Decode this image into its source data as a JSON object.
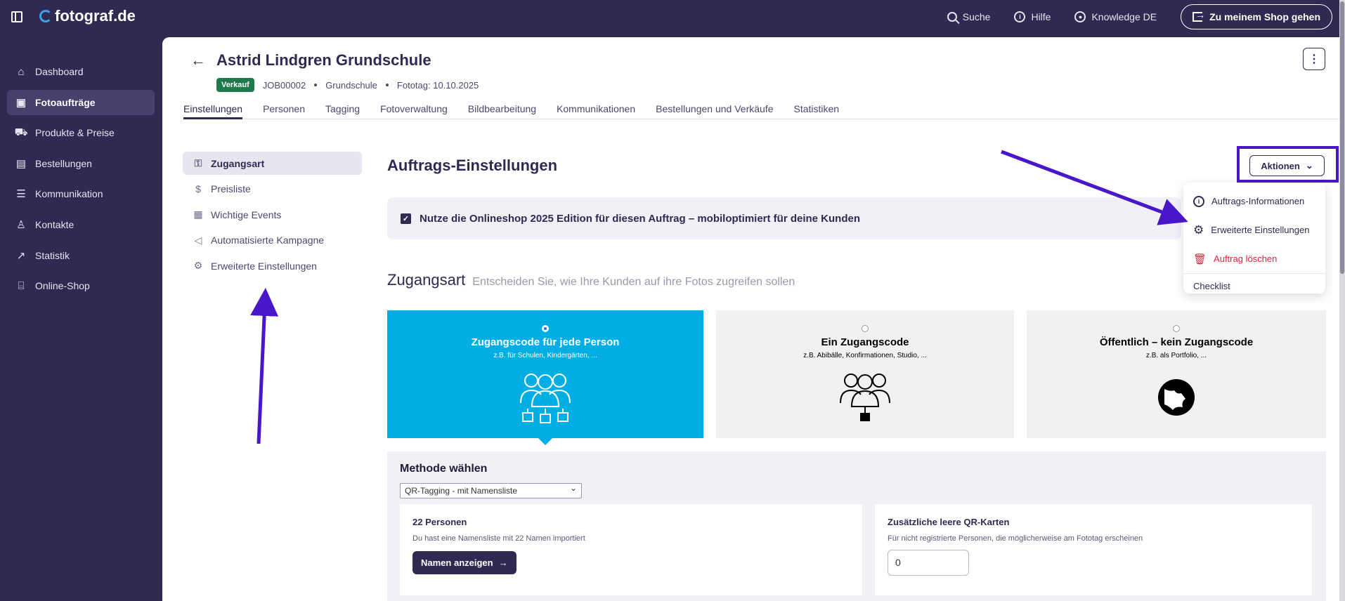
{
  "brand": {
    "name": "fotograf.de"
  },
  "topbar": {
    "search_label": "Suche",
    "help_label": "Hilfe",
    "knowledge_label": "Knowledge DE",
    "shop_button_label": "Zu meinem Shop gehen"
  },
  "sidebar": {
    "items": [
      {
        "label": "Dashboard",
        "icon": "home-icon"
      },
      {
        "label": "Fotoaufträge",
        "icon": "image-icon"
      },
      {
        "label": "Produkte & Preise",
        "icon": "cart-icon"
      },
      {
        "label": "Bestellungen",
        "icon": "box-icon"
      },
      {
        "label": "Kommunikation",
        "icon": "message-icon"
      },
      {
        "label": "Kontakte",
        "icon": "user-icon"
      },
      {
        "label": "Statistik",
        "icon": "chart-icon"
      },
      {
        "label": "Online-Shop",
        "icon": "store-icon"
      }
    ],
    "active_index": 1
  },
  "job": {
    "title": "Astrid Lindgren Grundschule",
    "status_badge": "Verkauf",
    "job_id": "JOB00002",
    "category": "Grundschule",
    "photo_day": "Fototag: 10.10.2025"
  },
  "tabs": [
    "Einstellungen",
    "Personen",
    "Tagging",
    "Fotoverwaltung",
    "Bildbearbeitung",
    "Kommunikationen",
    "Bestellungen und Verkäufe",
    "Statistiken"
  ],
  "subnav": [
    "Zugangsart",
    "Preisliste",
    "Wichtige Events",
    "Automatisierte Kampagne",
    "Erweiterte Einstellungen"
  ],
  "settings": {
    "title": "Auftrags-Einstellungen",
    "actions_label": "Aktionen",
    "edition_checkbox_label": "Nutze die Onlineshop 2025 Edition für diesen Auftrag – mobiloptimiert für deine Kunden",
    "edition_checked": true
  },
  "access": {
    "title": "Zugangsart",
    "subtitle": "Entscheiden Sie, wie Ihre Kunden auf ihre Fotos zugreifen sollen",
    "cards": [
      {
        "title": "Zugangscode für jede Person",
        "sub": "z.B. für Schulen, Kindergärten, ...",
        "selected": true
      },
      {
        "title": "Ein Zugangscode",
        "sub": "z.B. Abibälle, Konfirmationen, Studio, ...",
        "selected": false
      },
      {
        "title": "Öffentlich – kein Zugangscode",
        "sub": "z.B. als Portfolio, ...",
        "selected": false
      }
    ]
  },
  "method": {
    "title": "Methode wählen",
    "selected": "QR-Tagging - mit Namensliste",
    "persons_title": "22 Personen",
    "persons_sub": "Du hast eine Namensliste mit 22 Namen importiert",
    "names_button": "Namen anzeigen",
    "qr_title": "Zusätzliche leere QR-Karten",
    "qr_sub": "Für nicht registrierte Personen, die möglicherweise am Fototag erscheinen",
    "qr_value": "0"
  },
  "dropdown": {
    "items": [
      {
        "label": "Auftrags-Informationen",
        "icon": "info-icon"
      },
      {
        "label": "Erweiterte Einstellungen",
        "icon": "gear-icon"
      },
      {
        "label": "Auftrag löschen",
        "icon": "trash-icon"
      },
      {
        "label": "Checklist"
      }
    ]
  },
  "colors": {
    "nav_bg": "#2e2a52",
    "accent_card": "#00aee4",
    "annotation": "#4a16c9",
    "danger": "#d8243a",
    "badge": "#1e7a4a"
  }
}
